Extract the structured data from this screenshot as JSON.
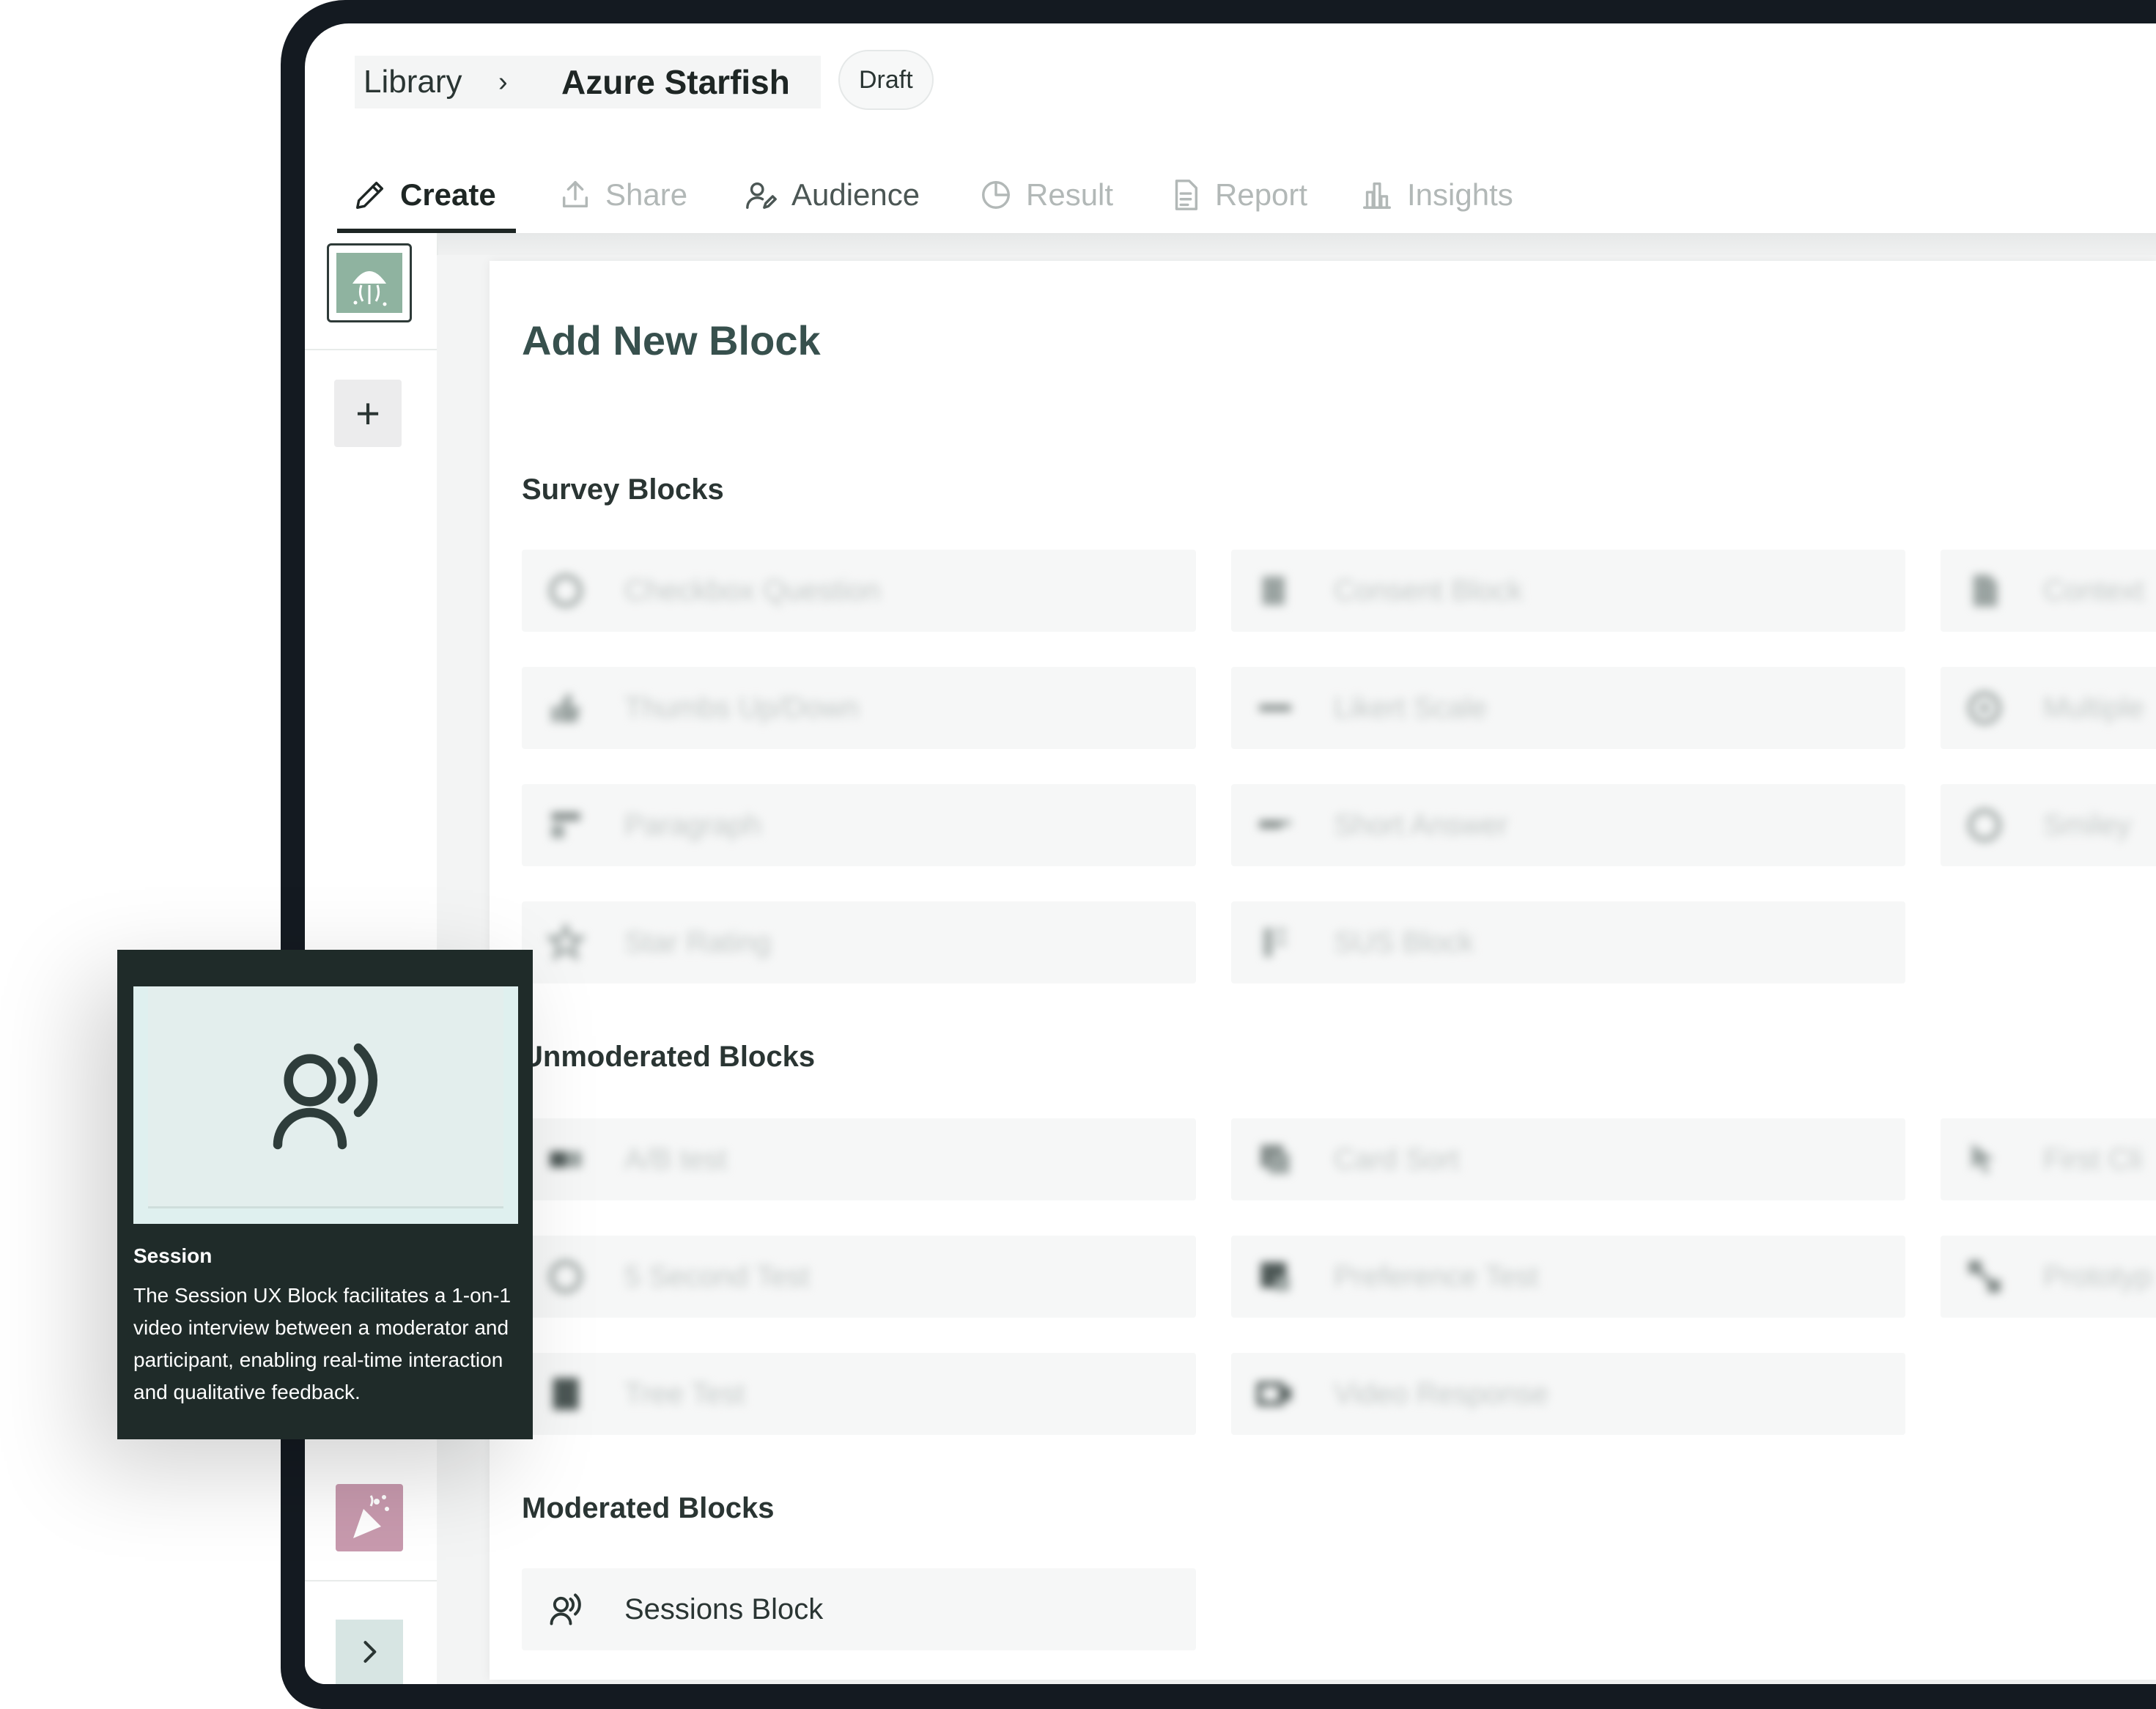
{
  "breadcrumb": {
    "root": "Library",
    "separator": "›",
    "current": "Azure Starfish",
    "status_badge": "Draft"
  },
  "tabs": [
    {
      "label": "Create",
      "icon": "pencil-icon",
      "state": "active"
    },
    {
      "label": "Share",
      "icon": "share-icon",
      "state": "disabled"
    },
    {
      "label": "Audience",
      "icon": "audience-icon",
      "state": "enabled"
    },
    {
      "label": "Result",
      "icon": "pie-chart-icon",
      "state": "disabled"
    },
    {
      "label": "Report",
      "icon": "document-icon",
      "state": "disabled"
    },
    {
      "label": "Insights",
      "icon": "bar-chart-icon",
      "state": "disabled"
    }
  ],
  "main": {
    "title": "Add New Block",
    "sections": {
      "survey": {
        "heading": "Survey Blocks",
        "items": [
          "Checkbox Question",
          "Consent Block",
          "Context",
          "Thumbs Up/Down",
          "Likert Scale",
          "Multiple",
          "Paragraph",
          "Short Answer",
          "Smiley",
          "Star Rating",
          "SUS Block"
        ]
      },
      "unmoderated": {
        "heading": "Unmoderated Blocks",
        "items": [
          "A/B test",
          "Card Sort",
          "First Cli",
          "5 Second Test",
          "Preference Test",
          "Prototyp",
          "Tree Test",
          "Video Response"
        ]
      },
      "moderated": {
        "heading": "Moderated Blocks",
        "items": [
          "Sessions Block"
        ]
      }
    }
  },
  "tooltip": {
    "title": "Session",
    "description": "The Session UX Block facilitates a 1-on-1 video interview between a moderator and participant, enabling real-time interaction and qualitative feedback.",
    "icon": "session-icon"
  },
  "rail": {
    "add_label": "+",
    "colors": {
      "thumb": "#8fb3a0",
      "party": "#c89aae",
      "expand": "#d7e5e3"
    }
  }
}
